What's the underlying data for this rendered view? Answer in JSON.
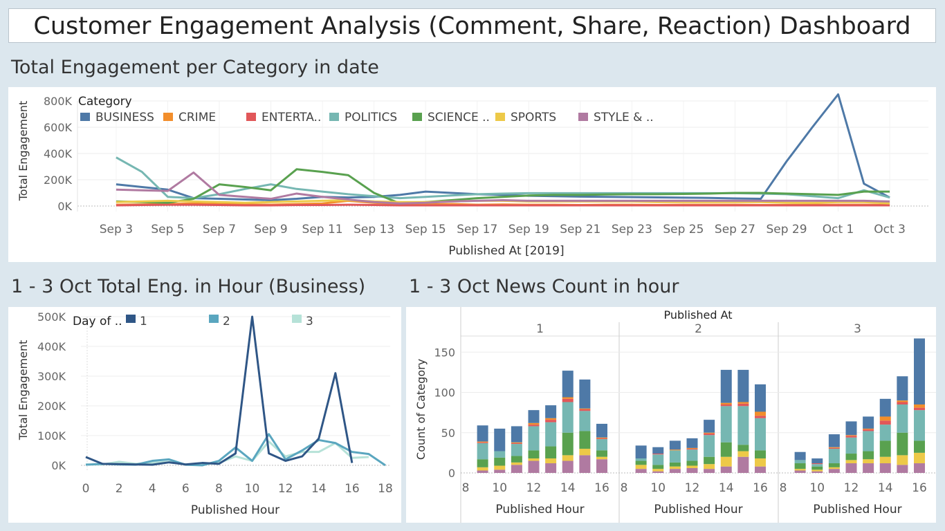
{
  "dashboard_title": "Customer Engagement Analysis (Comment, Share, Reaction) Dashboard",
  "sections": {
    "top": "Total Engagement per Category in date",
    "bottom_left": "1 - 3 Oct Total Eng. in Hour (Business)",
    "bottom_right": "1 - 3 Oct News Count in hour"
  },
  "chart_data": [
    {
      "type": "line",
      "legend_title": "Category",
      "xlabel": "Published At [2019]",
      "ylabel": "Total Engagement",
      "ylim": [
        0,
        800000
      ],
      "yticks": [
        0,
        200000,
        400000,
        600000,
        800000
      ],
      "ytick_labels": [
        "0K",
        "200K",
        "400K",
        "600K",
        "800K"
      ],
      "xticks": [
        3,
        5,
        7,
        9,
        11,
        13,
        15,
        17,
        19,
        21,
        23,
        25,
        27,
        29,
        31,
        33
      ],
      "xtick_labels": [
        "Sep 3",
        "Sep 5",
        "Sep 7",
        "Sep 9",
        "Sep 11",
        "Sep 13",
        "Sep 15",
        "Sep 17",
        "Sep 19",
        "Sep 21",
        "Sep 23",
        "Sep 25",
        "Sep 27",
        "Sep 29",
        "Oct 1",
        "Oct 3"
      ],
      "x_unit_note": "x values are day numbers counted from Sep 1 (Oct 1 = 31)",
      "x": [
        3,
        4,
        5,
        6,
        7,
        8,
        9,
        10,
        11,
        12,
        13,
        14,
        15,
        16,
        17,
        18,
        19,
        20,
        21,
        22,
        23,
        24,
        25,
        26,
        27,
        28,
        29,
        30,
        31,
        32,
        33
      ],
      "series": [
        {
          "name": "BUSINESS",
          "color": "#4e79a7",
          "values": [
            165000,
            145000,
            125000,
            60000,
            55000,
            50000,
            45000,
            55000,
            70000,
            65000,
            70000,
            85000,
            110000,
            100000,
            90000,
            85000,
            78000,
            75000,
            72000,
            70000,
            68000,
            66000,
            64000,
            62000,
            58000,
            55000,
            340000,
            600000,
            850000,
            170000,
            65000
          ]
        },
        {
          "name": "CRIME",
          "color": "#f28e2b",
          "values": [
            10000,
            12000,
            15000,
            20000,
            15000,
            12000,
            10000,
            15000,
            20000,
            40000,
            25000,
            15000,
            12000,
            15000,
            10000,
            12000,
            10000,
            10000,
            8000,
            10000,
            10000,
            8000,
            10000,
            10000,
            10000,
            8000,
            8000,
            10000,
            10000,
            10000,
            8000
          ]
        },
        {
          "name": "ENTERTA..",
          "color": "#e15759",
          "values": [
            5000,
            8000,
            10000,
            10000,
            8000,
            5000,
            5000,
            8000,
            8000,
            10000,
            8000,
            5000,
            5000,
            5000,
            5000,
            5000,
            5000,
            5000,
            5000,
            5000,
            5000,
            5000,
            5000,
            5000,
            5000,
            5000,
            5000,
            5000,
            5000,
            5000,
            5000
          ]
        },
        {
          "name": "POLITICS",
          "color": "#76b7b2",
          "values": [
            370000,
            260000,
            70000,
            60000,
            90000,
            130000,
            165000,
            130000,
            110000,
            90000,
            75000,
            60000,
            70000,
            80000,
            90000,
            95000,
            98000,
            98000,
            98000,
            98000,
            98000,
            98000,
            98000,
            98000,
            98000,
            95000,
            90000,
            75000,
            60000,
            120000,
            65000
          ]
        },
        {
          "name": "SCIENCE ..",
          "color": "#59a14f",
          "values": [
            35000,
            30000,
            25000,
            55000,
            165000,
            145000,
            120000,
            280000,
            260000,
            235000,
            100000,
            20000,
            30000,
            45000,
            60000,
            70000,
            80000,
            85000,
            85000,
            88000,
            90000,
            90000,
            92000,
            95000,
            100000,
            100000,
            95000,
            90000,
            85000,
            110000,
            110000
          ]
        },
        {
          "name": "SPORTS",
          "color": "#edc948",
          "values": [
            30000,
            35000,
            40000,
            35000,
            30000,
            25000,
            30000,
            35000,
            40000,
            45000,
            35000,
            30000,
            30000,
            35000,
            40000,
            40000,
            35000,
            35000,
            35000,
            35000,
            35000,
            30000,
            30000,
            30000,
            30000,
            30000,
            25000,
            25000,
            30000,
            30000,
            20000
          ]
        },
        {
          "name": "STYLE & ..",
          "color": "#b07aa1",
          "values": [
            125000,
            120000,
            115000,
            255000,
            85000,
            70000,
            55000,
            95000,
            70000,
            50000,
            30000,
            20000,
            25000,
            35000,
            40000,
            45000,
            40000,
            40000,
            40000,
            40000,
            40000,
            40000,
            40000,
            40000,
            40000,
            40000,
            40000,
            40000,
            40000,
            40000,
            35000
          ]
        }
      ]
    },
    {
      "type": "line",
      "legend_title": "Day of ..",
      "xlabel": "Published Hour",
      "ylabel": "Total Engagement",
      "xlim": [
        0,
        18
      ],
      "xticks": [
        0,
        2,
        4,
        6,
        8,
        10,
        12,
        14,
        16,
        18
      ],
      "ylim": [
        0,
        500000
      ],
      "yticks": [
        0,
        100000,
        200000,
        300000,
        400000,
        500000
      ],
      "ytick_labels": [
        "0K",
        "100K",
        "200K",
        "300K",
        "400K",
        "500K"
      ],
      "series": [
        {
          "name": "1",
          "color": "#2f5686",
          "x": [
            0,
            1,
            2,
            3,
            4,
            5,
            6,
            7,
            8,
            9,
            10,
            11,
            12,
            13,
            14,
            15,
            16
          ],
          "values": [
            28000,
            5000,
            4000,
            3000,
            2000,
            10000,
            3000,
            8000,
            5000,
            40000,
            500000,
            40000,
            15000,
            30000,
            90000,
            310000,
            8000
          ]
        },
        {
          "name": "2",
          "color": "#5aa6bf",
          "x": [
            0,
            1,
            2,
            3,
            4,
            5,
            6,
            7,
            8,
            9,
            10,
            11,
            12,
            13,
            14,
            15,
            16,
            17,
            18
          ],
          "values": [
            2000,
            5000,
            3000,
            2000,
            15000,
            20000,
            2000,
            0,
            15000,
            60000,
            15000,
            105000,
            20000,
            50000,
            85000,
            75000,
            45000,
            38000,
            0
          ]
        },
        {
          "name": "3",
          "color": "#b6e2d8",
          "x": [
            0,
            1,
            2,
            3,
            4,
            5,
            6,
            7,
            8,
            9,
            10,
            11,
            12,
            13,
            14,
            15,
            16,
            17
          ],
          "values": [
            3000,
            3000,
            12000,
            5000,
            8000,
            12000,
            3000,
            3000,
            8000,
            30000,
            15000,
            80000,
            30000,
            45000,
            45000,
            75000,
            25000,
            28000
          ]
        }
      ]
    },
    {
      "type": "bar",
      "stacked": true,
      "facet_title": "Published At",
      "facets": [
        "1",
        "2",
        "3"
      ],
      "xlabel": "Published Hour",
      "ylabel": "Count of Category",
      "ylim": [
        0,
        170
      ],
      "yticks": [
        0,
        50,
        100,
        150
      ],
      "xticks": [
        8,
        10,
        12,
        14,
        16
      ],
      "series_order": [
        "STYLE & ..",
        "SPORTS",
        "SCIENCE ..",
        "POLITICS",
        "ENTERTA..",
        "CRIME",
        "BUSINESS"
      ],
      "series_colors": [
        "#b07aa1",
        "#edc948",
        "#59a14f",
        "#76b7b2",
        "#e15759",
        "#f28e2b",
        "#4e79a7"
      ],
      "panels": [
        {
          "facet": "1",
          "bars": [
            {
              "hour": 9,
              "values": [
                3,
                4,
                10,
                20,
                1,
                1,
                20
              ]
            },
            {
              "hour": 10,
              "values": [
                4,
                5,
                10,
                8,
                0,
                0,
                28
              ]
            },
            {
              "hour": 11,
              "values": [
                10,
                3,
                8,
                15,
                1,
                1,
                20
              ]
            },
            {
              "hour": 12,
              "values": [
                15,
                3,
                10,
                30,
                2,
                2,
                16
              ]
            },
            {
              "hour": 13,
              "values": [
                12,
                6,
                15,
                30,
                3,
                2,
                16
              ]
            },
            {
              "hour": 14,
              "values": [
                15,
                7,
                28,
                38,
                4,
                2,
                33
              ]
            },
            {
              "hour": 15,
              "values": [
                22,
                8,
                22,
                25,
                2,
                1,
                36
              ]
            },
            {
              "hour": 16,
              "values": [
                17,
                3,
                8,
                14,
                1,
                1,
                17
              ]
            }
          ]
        },
        {
          "facet": "2",
          "bars": [
            {
              "hour": 9,
              "values": [
                5,
                5,
                5,
                3,
                0,
                0,
                16
              ]
            },
            {
              "hour": 10,
              "values": [
                2,
                3,
                5,
                13,
                1,
                0,
                8
              ]
            },
            {
              "hour": 11,
              "values": [
                5,
                3,
                5,
                15,
                0,
                1,
                11
              ]
            },
            {
              "hour": 12,
              "values": [
                6,
                3,
                6,
                14,
                1,
                1,
                12
              ]
            },
            {
              "hour": 13,
              "values": [
                5,
                6,
                9,
                27,
                2,
                1,
                16
              ]
            },
            {
              "hour": 14,
              "values": [
                8,
                12,
                18,
                45,
                2,
                2,
                41
              ]
            },
            {
              "hour": 15,
              "values": [
                20,
                7,
                8,
                48,
                3,
                2,
                40
              ]
            },
            {
              "hour": 16,
              "values": [
                8,
                10,
                10,
                40,
                3,
                5,
                34
              ]
            }
          ]
        },
        {
          "facet": "3",
          "bars": [
            {
              "hour": 9,
              "values": [
                3,
                2,
                7,
                4,
                0,
                0,
                10
              ]
            },
            {
              "hour": 10,
              "values": [
                2,
                2,
                4,
                3,
                1,
                0,
                6
              ]
            },
            {
              "hour": 11,
              "values": [
                5,
                2,
                5,
                18,
                1,
                1,
                16
              ]
            },
            {
              "hour": 12,
              "values": [
                12,
                4,
                8,
                20,
                2,
                1,
                17
              ]
            },
            {
              "hour": 13,
              "values": [
                12,
                5,
                10,
                25,
                2,
                1,
                15
              ]
            },
            {
              "hour": 14,
              "values": [
                12,
                8,
                20,
                20,
                5,
                5,
                22
              ]
            },
            {
              "hour": 15,
              "values": [
                10,
                12,
                28,
                35,
                3,
                2,
                30
              ]
            },
            {
              "hour": 16,
              "values": [
                12,
                13,
                15,
                38,
                3,
                4,
                82
              ]
            }
          ]
        }
      ]
    }
  ]
}
